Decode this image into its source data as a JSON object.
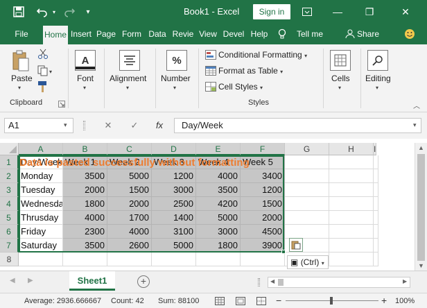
{
  "app": {
    "title": "Book1  -  Excel",
    "sign_in": "Sign in",
    "brand_color": "#217346",
    "accent_orange": "#ed7d31"
  },
  "quick_access": {
    "save_icon": "save-icon",
    "undo_icon": "undo-icon",
    "redo_icon": "redo-icon",
    "customize_icon": "customize-qat-icon"
  },
  "window_controls": {
    "ribbon_options": "ribbon-display-icon",
    "minimize": "—",
    "restore": "❐",
    "close": "✕"
  },
  "tabs": [
    "File",
    "Home",
    "Insert",
    "Page",
    "Form",
    "Data",
    "Revie",
    "View",
    "Devel",
    "Help"
  ],
  "tell_me": "Tell me",
  "share": "Share",
  "ribbon": {
    "clipboard": {
      "paste": "Paste",
      "label": "Clipboard"
    },
    "font": {
      "label": "Font",
      "icon_glyph": "A"
    },
    "alignment": {
      "label": "Alignment"
    },
    "number": {
      "label": "Number",
      "icon_glyph": "%"
    },
    "styles": {
      "conditional_formatting": "Conditional Formatting",
      "format_as_table": "Format as Table",
      "cell_styles": "Cell Styles",
      "label": "Styles"
    },
    "cells": {
      "label": "Cells"
    },
    "editing": {
      "label": "Editing"
    }
  },
  "formula_bar": {
    "name_box": "A1",
    "cancel": "✕",
    "enter": "✓",
    "fx": "fx",
    "formula": "Day/Week"
  },
  "grid": {
    "columns": [
      "A",
      "B",
      "C",
      "D",
      "E",
      "F",
      "G",
      "H",
      "I"
    ],
    "rows": [
      "1",
      "2",
      "3",
      "4",
      "5",
      "6",
      "7",
      "8"
    ],
    "overlay_text": "Data is pasted successfully without formatting",
    "header_row": [
      "Day/Week",
      "Week 1",
      "Week 2",
      "Week 3",
      "Week 4",
      "Week 5"
    ],
    "data_rows": [
      [
        "Monday",
        "3500",
        "5000",
        "1200",
        "4000",
        "3400"
      ],
      [
        "Tuesday",
        "2000",
        "1500",
        "3000",
        "3500",
        "1200"
      ],
      [
        "Wednesday",
        "1800",
        "2000",
        "2500",
        "4200",
        "1500"
      ],
      [
        "Thrusday",
        "4000",
        "1700",
        "1400",
        "5000",
        "2000"
      ],
      [
        "Friday",
        "2300",
        "4000",
        "3100",
        "3000",
        "4500"
      ],
      [
        "Saturday",
        "3500",
        "2600",
        "5000",
        "1800",
        "3900"
      ]
    ],
    "paste_options": "(Ctrl)"
  },
  "sheets": {
    "active": "Sheet1"
  },
  "status": {
    "average": "Average: 2936.666667",
    "count": "Count: 42",
    "sum": "Sum: 88100",
    "zoom": "100%"
  }
}
